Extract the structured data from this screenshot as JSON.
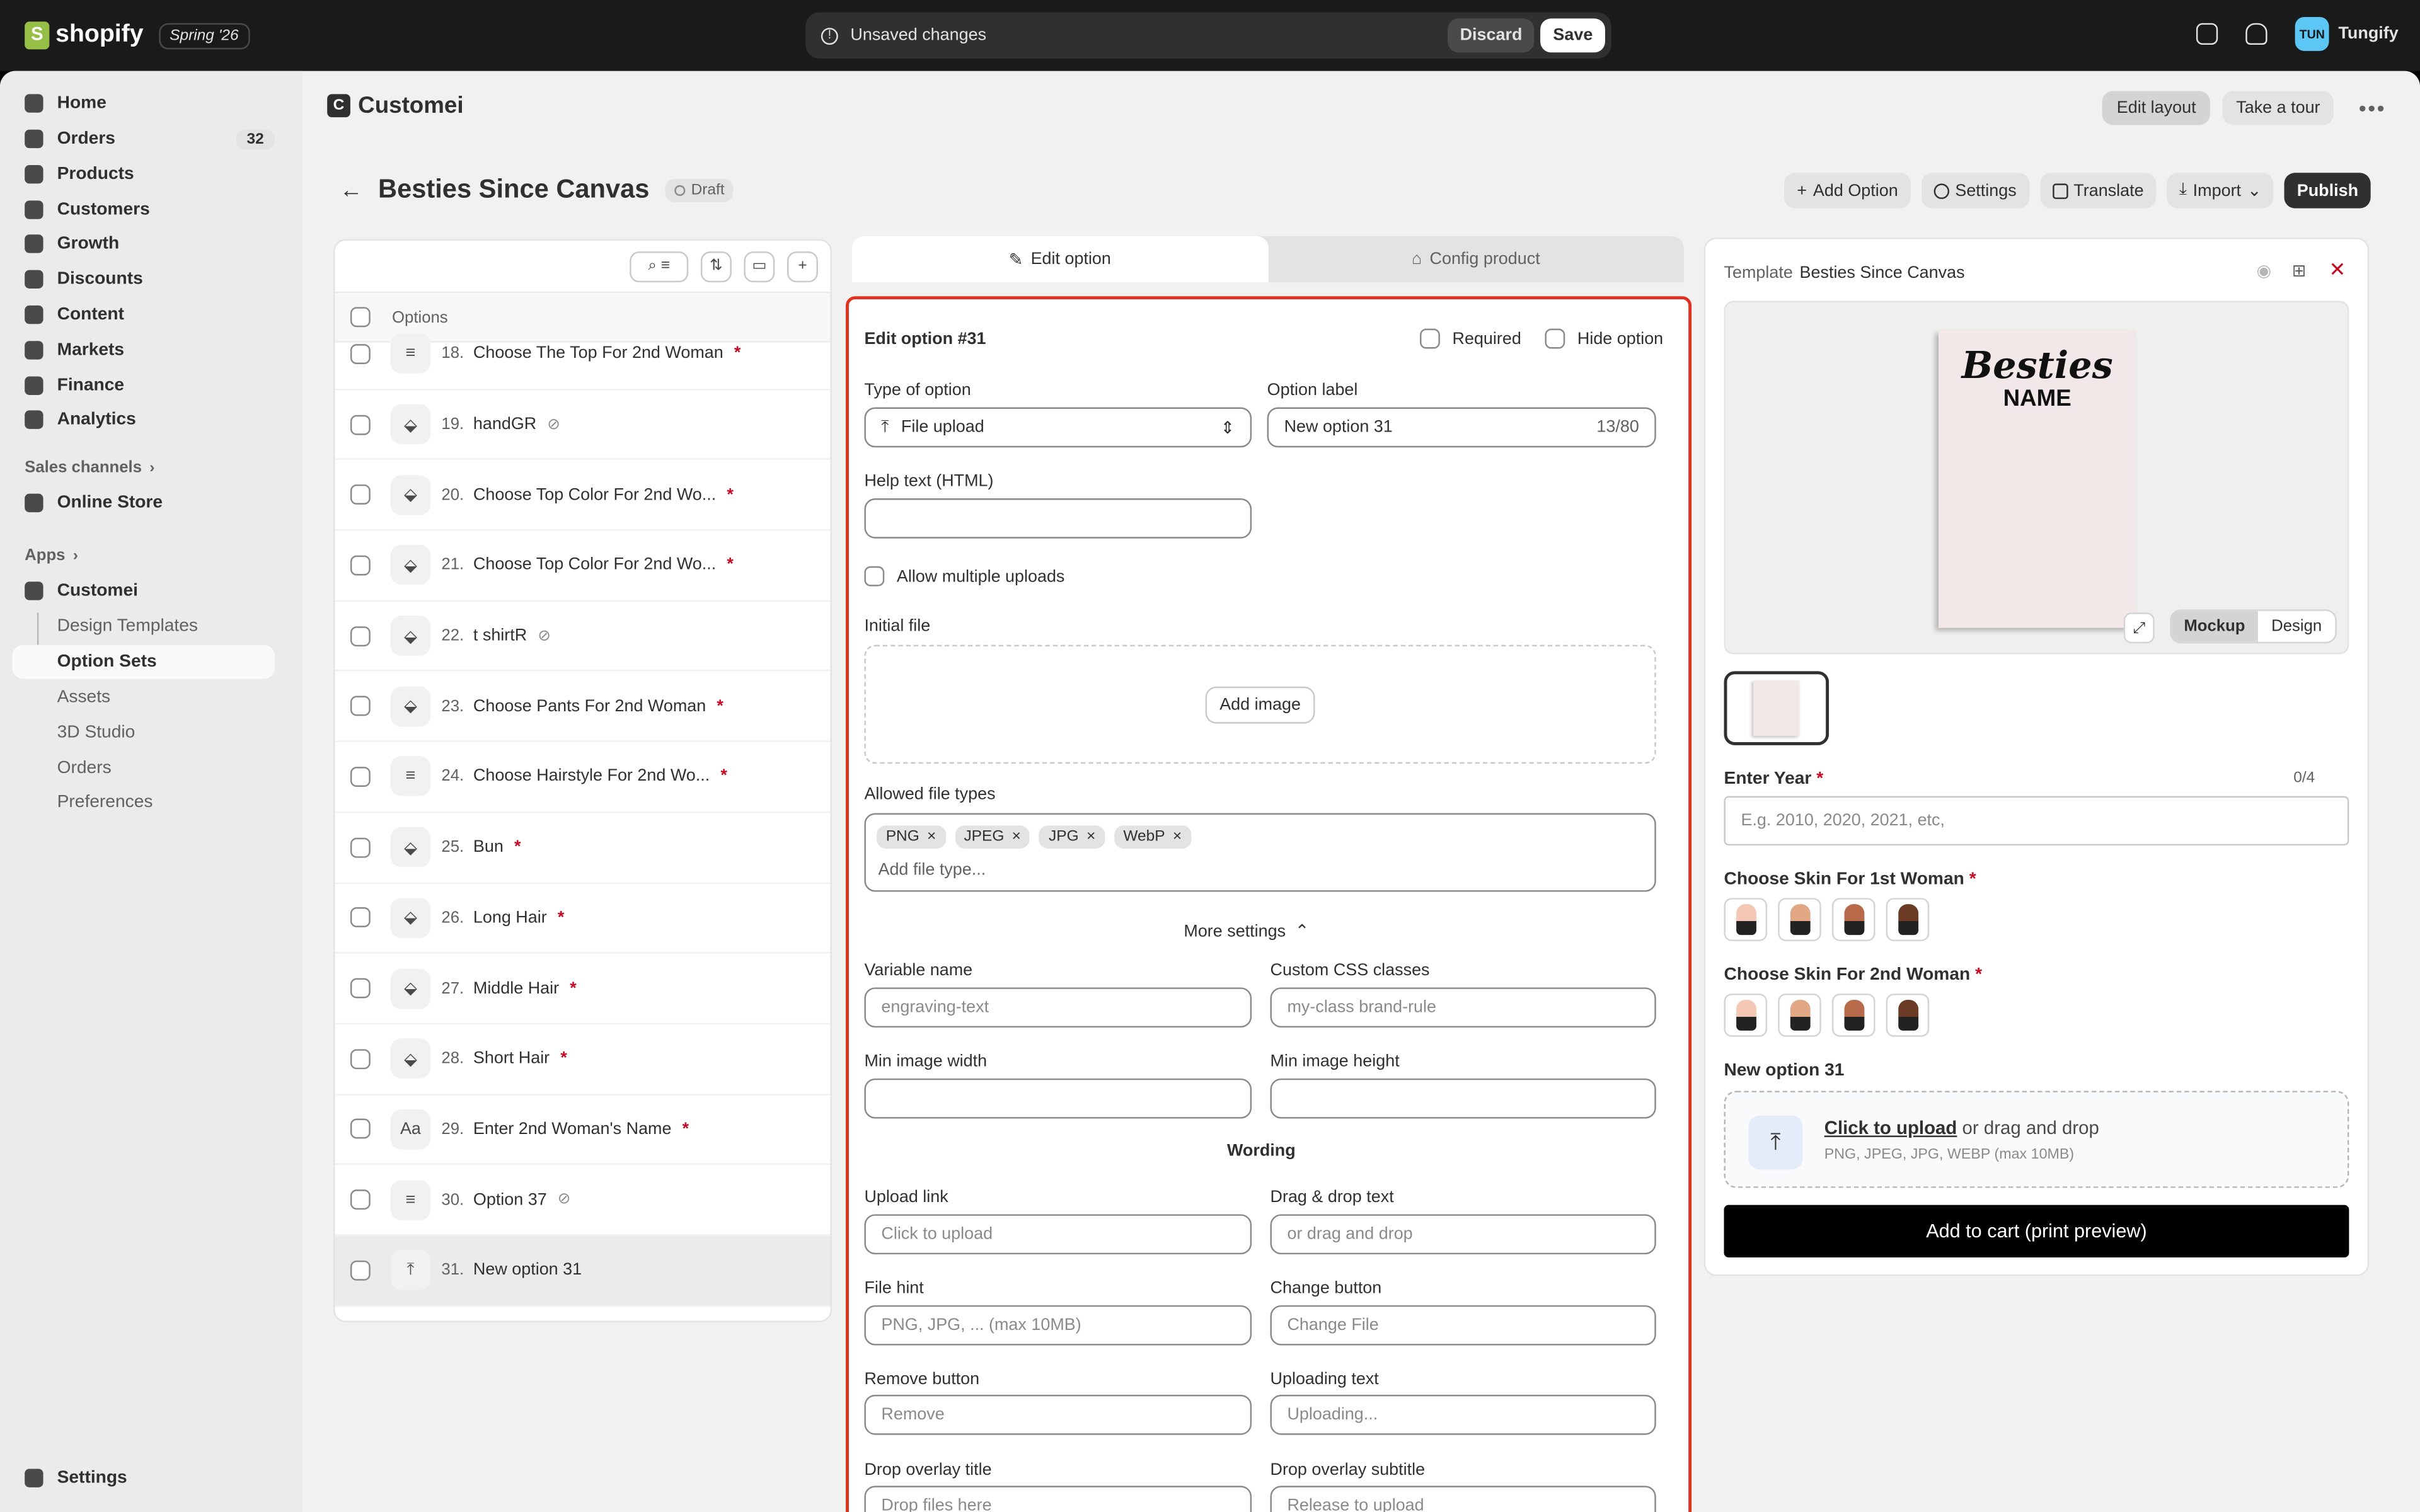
{
  "topbar": {
    "brand": "shopify",
    "edition": "Spring '26",
    "unsaved_text": "Unsaved changes",
    "discard": "Discard",
    "save": "Save",
    "avatar_initials": "TUN",
    "store_name": "Tungify"
  },
  "sidebar": {
    "items": [
      {
        "label": "Home",
        "icon": "home-icon"
      },
      {
        "label": "Orders",
        "icon": "orders-icon",
        "badge": "32"
      },
      {
        "label": "Products",
        "icon": "tag-icon"
      },
      {
        "label": "Customers",
        "icon": "person-icon"
      },
      {
        "label": "Growth",
        "icon": "growth-icon"
      },
      {
        "label": "Discounts",
        "icon": "discount-icon"
      },
      {
        "label": "Content",
        "icon": "content-icon"
      },
      {
        "label": "Markets",
        "icon": "globe-icon"
      },
      {
        "label": "Finance",
        "icon": "bank-icon"
      },
      {
        "label": "Analytics",
        "icon": "chart-icon"
      }
    ],
    "sales_channels": "Sales channels",
    "online_store": "Online Store",
    "apps": "Apps",
    "app_name": "Customei",
    "app_subitems": [
      "Design Templates",
      "Option Sets",
      "Assets",
      "3D Studio",
      "Orders",
      "Preferences"
    ],
    "settings": "Settings"
  },
  "app": {
    "name": "Customei",
    "edit_layout": "Edit layout",
    "take_tour": "Take a tour"
  },
  "page": {
    "title": "Besties Since Canvas",
    "status": "Draft",
    "actions": {
      "add_option": "Add Option",
      "settings": "Settings",
      "translate": "Translate",
      "import": "Import",
      "publish": "Publish"
    }
  },
  "options_panel": {
    "header": "Options",
    "rows": [
      {
        "num": "18.",
        "label": "Choose The Top For 2nd Woman",
        "required": true,
        "hidden": false,
        "icon": "list-icon"
      },
      {
        "num": "19.",
        "label": "handGR",
        "required": false,
        "hidden": true,
        "icon": "paint-bucket-icon"
      },
      {
        "num": "20.",
        "label": "Choose Top Color For 2nd Wo...",
        "required": true,
        "hidden": false,
        "icon": "paint-bucket-icon"
      },
      {
        "num": "21.",
        "label": "Choose Top Color For 2nd Wo...",
        "required": true,
        "hidden": false,
        "icon": "paint-bucket-icon"
      },
      {
        "num": "22.",
        "label": "t shirtR",
        "required": false,
        "hidden": true,
        "icon": "paint-bucket-icon"
      },
      {
        "num": "23.",
        "label": "Choose Pants For 2nd Woman",
        "required": true,
        "hidden": false,
        "icon": "paint-bucket-icon"
      },
      {
        "num": "24.",
        "label": "Choose Hairstyle For 2nd Wo...",
        "required": true,
        "hidden": false,
        "icon": "list-icon"
      },
      {
        "num": "25.",
        "label": "Bun",
        "required": true,
        "hidden": false,
        "icon": "paint-bucket-icon"
      },
      {
        "num": "26.",
        "label": "Long Hair",
        "required": true,
        "hidden": false,
        "icon": "paint-bucket-icon"
      },
      {
        "num": "27.",
        "label": "Middle Hair",
        "required": true,
        "hidden": false,
        "icon": "paint-bucket-icon"
      },
      {
        "num": "28.",
        "label": "Short Hair",
        "required": true,
        "hidden": false,
        "icon": "paint-bucket-icon"
      },
      {
        "num": "29.",
        "label": "Enter 2nd Woman's Name",
        "required": true,
        "hidden": false,
        "icon": "text-icon"
      },
      {
        "num": "30.",
        "label": "Option 37",
        "required": false,
        "hidden": true,
        "icon": "list-icon"
      },
      {
        "num": "31.",
        "label": "New option 31",
        "required": false,
        "hidden": false,
        "icon": "upload-icon"
      }
    ]
  },
  "tabs": {
    "edit": "Edit option",
    "config": "Config product"
  },
  "edit": {
    "title": "Edit option #31",
    "required": "Required",
    "hide": "Hide option",
    "type_label": "Type of option",
    "type_value": "File upload",
    "option_label": "Option label",
    "option_value": "New option 31",
    "option_count": "13/80",
    "help_label": "Help text (HTML)",
    "allow_multiple": "Allow multiple uploads",
    "initial_file": "Initial file",
    "add_image": "Add image",
    "allowed_types": "Allowed file types",
    "types": [
      "PNG",
      "JPEG",
      "JPG",
      "WebP"
    ],
    "add_type_placeholder": "Add file type...",
    "more_settings": "More settings",
    "variable_label": "Variable name",
    "variable_ph": "engraving-text",
    "css_label": "Custom CSS classes",
    "css_ph": "my-class brand-rule",
    "min_w": "Min image width",
    "min_h": "Min image height",
    "wording": "Wording",
    "upload_link": "Upload link",
    "upload_link_ph": "Click to upload",
    "drag_text": "Drag & drop text",
    "drag_text_ph": "or drag and drop",
    "file_hint": "File hint",
    "file_hint_ph": "PNG, JPG, ... (max 10MB)",
    "change_button": "Change button",
    "change_button_ph": "Change File",
    "remove_button": "Remove button",
    "remove_button_ph": "Remove",
    "uploading_text": "Uploading text",
    "uploading_text_ph": "Uploading...",
    "drop_title": "Drop overlay title",
    "drop_title_ph": "Drop files here",
    "drop_sub": "Drop overlay subtitle",
    "drop_sub_ph": "Release to upload"
  },
  "preview": {
    "template_label": "Template",
    "template_name": "Besties Since Canvas",
    "canvas_title": "Besties",
    "canvas_name": "NAME",
    "mockup": "Mockup",
    "design": "Design",
    "year_label": "Enter Year",
    "year_count": "0/4",
    "year_ph": "E.g. 2010, 2020, 2021, etc,",
    "skin1_label": "Choose Skin For 1st Woman",
    "skin2_label": "Choose Skin For 2nd Woman",
    "skin_colors": [
      "#f3c7b4",
      "#e2a886",
      "#b86b4b",
      "#6b3b26"
    ],
    "new_option": "New option 31",
    "click_upload": "Click to upload",
    "drag_drop": "or drag and drop",
    "upload_hint": "PNG, JPEG, JPG, WEBP (max 10MB)",
    "add_to_cart": "Add to cart (print preview)"
  }
}
